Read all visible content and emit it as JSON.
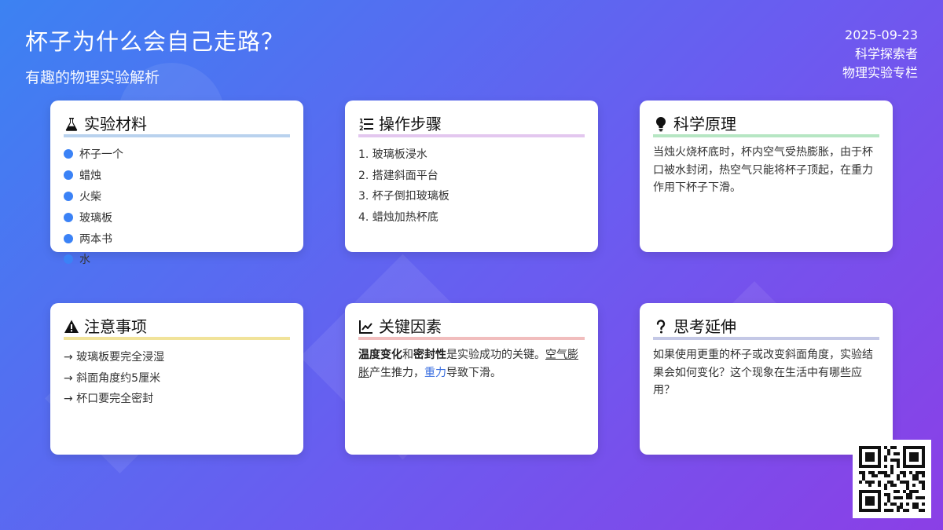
{
  "header": {
    "title": "杯子为什么会自己走路？",
    "subtitle": "有趣的物理实验解析",
    "date": "2025-09-23",
    "author": "科学探索者",
    "column": "物理实验专栏"
  },
  "cards": {
    "materials": {
      "title": "实验材料",
      "icon": "flask-icon",
      "items": [
        "杯子一个",
        "蜡烛",
        "火柴",
        "玻璃板",
        "两本书",
        "水"
      ]
    },
    "steps": {
      "title": "操作步骤",
      "icon": "numbered-list-icon",
      "items": [
        "1. 玻璃板浸水",
        "2. 搭建斜面平台",
        "3. 杯子倒扣玻璃板",
        "4. 蜡烛加热杯底"
      ]
    },
    "principle": {
      "title": "科学原理",
      "icon": "lightbulb-icon",
      "text": "当烛火烧杯底时，杯内空气受热膨胀，由于杯口被水封闭，热空气只能将杯子顶起，在重力作用下杯子下滑。"
    },
    "cautions": {
      "title": "注意事项",
      "icon": "warning-icon",
      "items": [
        "→ 玻璃板要完全浸湿",
        "→ 斜面角度约5厘米",
        "→ 杯口要完全密封"
      ]
    },
    "factors": {
      "title": "关键因素",
      "icon": "line-chart-icon",
      "bold1": "温度变化",
      "and": "和",
      "bold2": "密封性",
      "mid": "是实验成功的关键。",
      "underline": "空气膨胀",
      "mid2": "产生推力，",
      "link": "重力",
      "end": "导致下滑。"
    },
    "thinking": {
      "title": "思考延伸",
      "icon": "question-icon",
      "text": "如果使用更重的杯子或改变斜面角度，实验结果会如何变化？这个现象在生活中有哪些应用？"
    }
  },
  "colors": {
    "bg_start": "#3c82f2",
    "bg_end": "#8b3fe6",
    "bullet": "#3b82f6",
    "link": "#3b6fe0"
  }
}
